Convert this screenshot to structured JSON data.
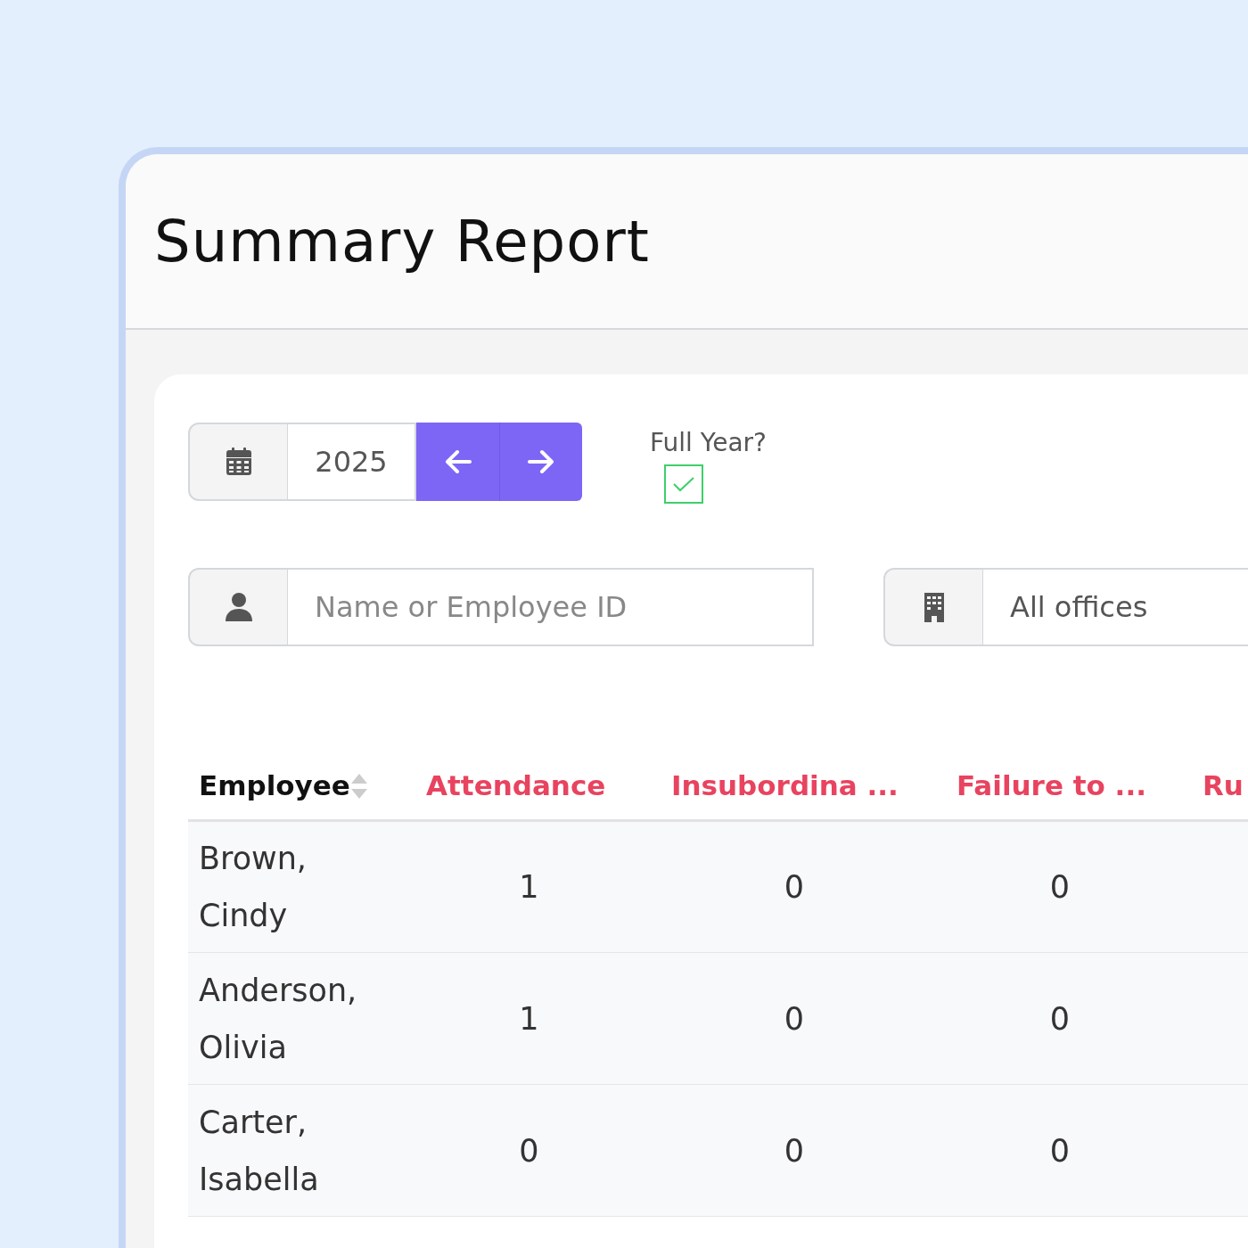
{
  "title": "Summary Report",
  "year_picker": {
    "value": "2025",
    "buttons": [
      {
        "kind": "prev"
      },
      {
        "kind": "next"
      }
    ]
  },
  "full_year": {
    "label": "Full Year?",
    "checked": true
  },
  "search": {
    "placeholder": "Name or Employee ID"
  },
  "office": {
    "value": "All offices"
  },
  "table": {
    "columns": [
      {
        "label": "Employee",
        "kind": "name"
      },
      {
        "label": "Attendance",
        "kind": "category"
      },
      {
        "label": "Insubordina ...",
        "kind": "category"
      },
      {
        "label": "Failure to ...",
        "kind": "category"
      },
      {
        "label": "Ru",
        "kind": "category"
      }
    ],
    "rows": [
      {
        "cells": [
          "Brown, Cindy",
          "1",
          "0",
          "0"
        ]
      },
      {
        "cells": [
          "Anderson, Olivia",
          "1",
          "0",
          "0"
        ]
      },
      {
        "cells": [
          "Carter, Isabella",
          "0",
          "0",
          "0"
        ]
      }
    ]
  }
}
